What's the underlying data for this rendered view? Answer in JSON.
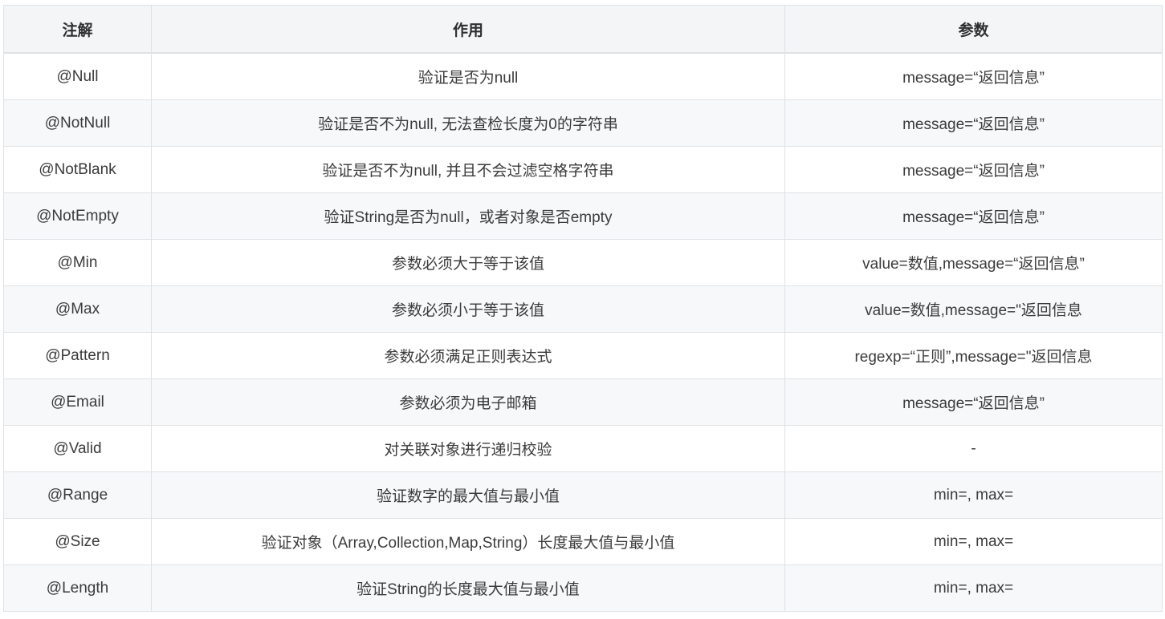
{
  "table": {
    "headers": [
      "注解",
      "作用",
      "参数"
    ],
    "rows": [
      [
        "@Null",
        "验证是否为null",
        "message=“返回信息”"
      ],
      [
        "@NotNull",
        "验证是否不为null, 无法查检长度为0的字符串",
        "message=“返回信息”"
      ],
      [
        "@NotBlank",
        "验证是否不为null, 并且不会过滤空格字符串",
        "message=“返回信息”"
      ],
      [
        "@NotEmpty",
        "验证String是否为null，或者对象是否empty",
        "message=“返回信息”"
      ],
      [
        "@Min",
        "参数必须大于等于该值",
        "value=数值,message=“返回信息”"
      ],
      [
        "@Max",
        "参数必须小于等于该值",
        "value=数值,message=\"返回信息"
      ],
      [
        "@Pattern",
        "参数必须满足正则表达式",
        "regexp=“正则”,message=\"返回信息"
      ],
      [
        "@Email",
        "参数必须为电子邮箱",
        "message=“返回信息”"
      ],
      [
        "@Valid",
        "对关联对象进行递归校验",
        "-"
      ],
      [
        "@Range",
        "验证数字的最大值与最小值",
        "min=, max="
      ],
      [
        "@Size",
        "验证对象（Array,Collection,Map,String）长度最大值与最小值",
        "min=, max="
      ],
      [
        "@Length",
        "验证String的长度最大值与最小值",
        "min=, max="
      ]
    ]
  }
}
